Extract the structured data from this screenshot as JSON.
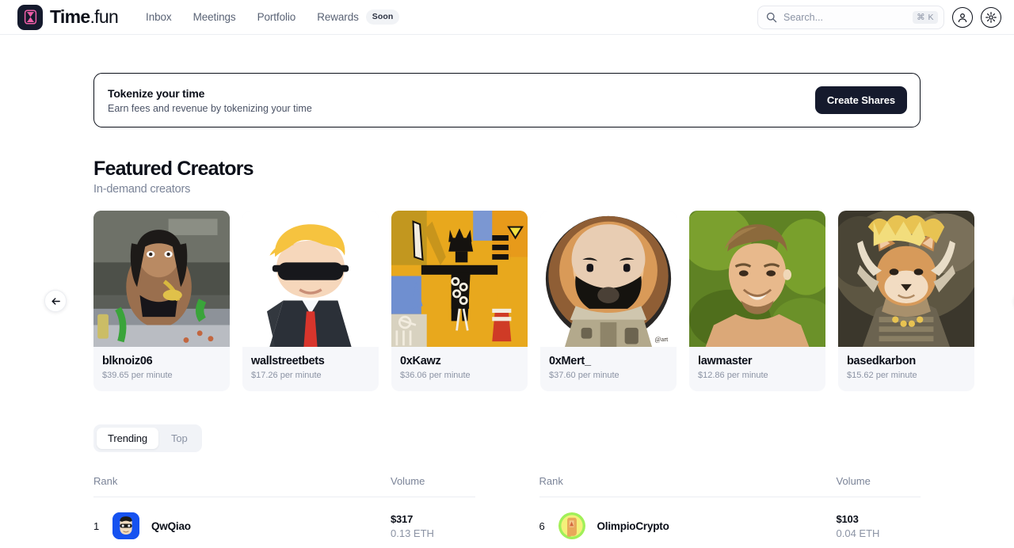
{
  "brand": {
    "name": "Time",
    "suffix": ".fun",
    "logo_icon": "hourglass-icon"
  },
  "nav": {
    "items": [
      {
        "label": "Inbox"
      },
      {
        "label": "Meetings"
      },
      {
        "label": "Portfolio"
      },
      {
        "label": "Rewards",
        "badge": "Soon"
      }
    ]
  },
  "search": {
    "placeholder": "Search...",
    "shortcut": "⌘ K",
    "icon": "search-icon"
  },
  "header_icons": {
    "account": "account-circle-icon",
    "settings": "gear-icon"
  },
  "banner": {
    "title": "Tokenize your time",
    "subtitle": "Earn fees and revenue by tokenizing your time",
    "cta": "Create Shares"
  },
  "featured": {
    "title": "Featured Creators",
    "subtitle": "In-demand creators",
    "prev_icon": "arrow-left-icon",
    "next_icon": "arrow-right-icon",
    "creators": [
      {
        "name": "blknoiz06",
        "rate": "$39.65 per minute",
        "art": "anime-woman"
      },
      {
        "name": "wallstreetbets",
        "rate": "$17.26 per minute",
        "art": "cartoon-trump"
      },
      {
        "name": "0xKawz",
        "rate": "$36.06 per minute",
        "art": "basquiat-painting"
      },
      {
        "name": "0xMert_",
        "rate": "$37.60 per minute",
        "art": "bald-cartoon-man"
      },
      {
        "name": "lawmaster",
        "rate": "$12.86 per minute",
        "art": "smiling-man-photo"
      },
      {
        "name": "basedkarbon",
        "rate": "$15.62 per minute",
        "art": "royal-fox-painting"
      }
    ]
  },
  "leaderboard": {
    "tabs": [
      {
        "label": "Trending",
        "active": true
      },
      {
        "label": "Top",
        "active": false
      }
    ],
    "columns": {
      "rank": "Rank",
      "volume": "Volume"
    },
    "left_rows": [
      {
        "rank": "1",
        "name": "QwQiao",
        "volume_usd": "$317",
        "volume_eth": "0.13 ETH",
        "avatar_bg": "#1652f0",
        "avatar_art": "blue-face-avatar"
      }
    ],
    "right_rows": [
      {
        "rank": "6",
        "name": "OlimpioCrypto",
        "volume_usd": "$103",
        "volume_eth": "0.04 ETH",
        "avatar_bg": "#f4f07a",
        "avatar_art": "yellow-green-avatar"
      }
    ]
  },
  "colors": {
    "brand_dark": "#151a2d",
    "logo_accent": "#ef5fa8",
    "text_primary": "#0b0f19",
    "text_muted": "#8b93a4",
    "surface": "#f6f7fa",
    "border": "#eceef2"
  }
}
